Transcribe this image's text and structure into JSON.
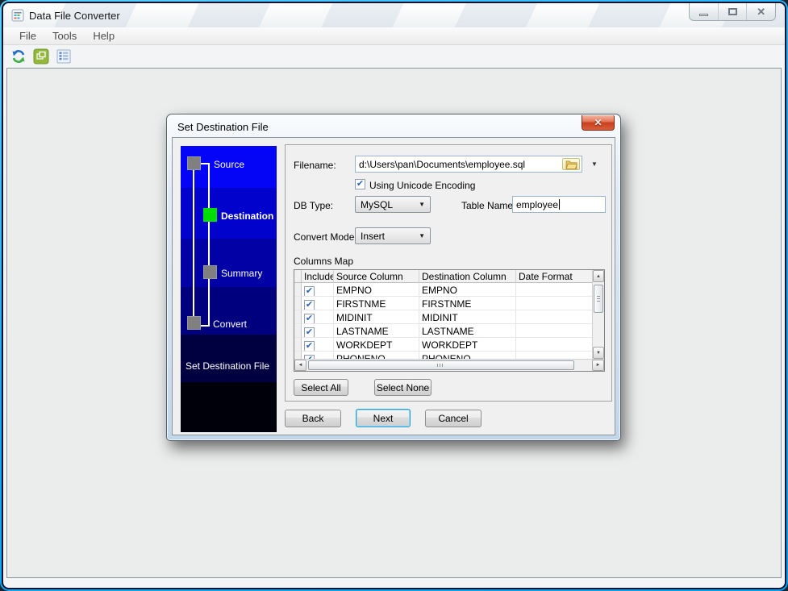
{
  "window": {
    "title": "Data File Converter",
    "menu": [
      "File",
      "Tools",
      "Help"
    ]
  },
  "toolbar": {
    "icons": [
      "convert-refresh",
      "batch-windows",
      "column-list"
    ]
  },
  "dialog": {
    "title": "Set Destination File",
    "wizard_steps": [
      {
        "label": "Source",
        "state": "inactive"
      },
      {
        "label": "Destination",
        "state": "active"
      },
      {
        "label": "Summary",
        "state": "inactive"
      },
      {
        "label": "Convert",
        "state": "inactive"
      }
    ],
    "wizard_caption": "Set Destination File",
    "form": {
      "filename_label": "Filename:",
      "filename_value": "d:\\Users\\pan\\Documents\\employee.sql",
      "unicode_checkbox_label": "Using Unicode Encoding",
      "unicode_checked": true,
      "db_type_label": "DB Type:",
      "db_type_value": "MySQL",
      "table_name_label": "Table Name:",
      "table_name_value": "employee",
      "convert_mode_label": "Convert Mode:",
      "convert_mode_value": "Insert",
      "columns_map_label": "Columns Map"
    },
    "table": {
      "headers": [
        "Include",
        "Source Column",
        "Destination Column",
        "Date Format"
      ],
      "rows": [
        {
          "include": true,
          "source": "EMPNO",
          "destination": "EMPNO",
          "date_format": ""
        },
        {
          "include": true,
          "source": "FIRSTNME",
          "destination": "FIRSTNME",
          "date_format": ""
        },
        {
          "include": true,
          "source": "MIDINIT",
          "destination": "MIDINIT",
          "date_format": ""
        },
        {
          "include": true,
          "source": "LASTNAME",
          "destination": "LASTNAME",
          "date_format": ""
        },
        {
          "include": true,
          "source": "WORKDEPT",
          "destination": "WORKDEPT",
          "date_format": ""
        },
        {
          "include": true,
          "source": "PHONENO",
          "destination": "PHONENO",
          "date_format": ""
        }
      ]
    },
    "buttons": {
      "select_all": "Select All",
      "select_none": "Select None",
      "back": "Back",
      "next": "Next",
      "cancel": "Cancel"
    }
  },
  "colors": {
    "active_step_green": "#00df00",
    "sidebar_blue_top": "#0404f6",
    "dialog_close_red": "#c93d1d",
    "window_edge_cyan": "#18a8f2"
  }
}
